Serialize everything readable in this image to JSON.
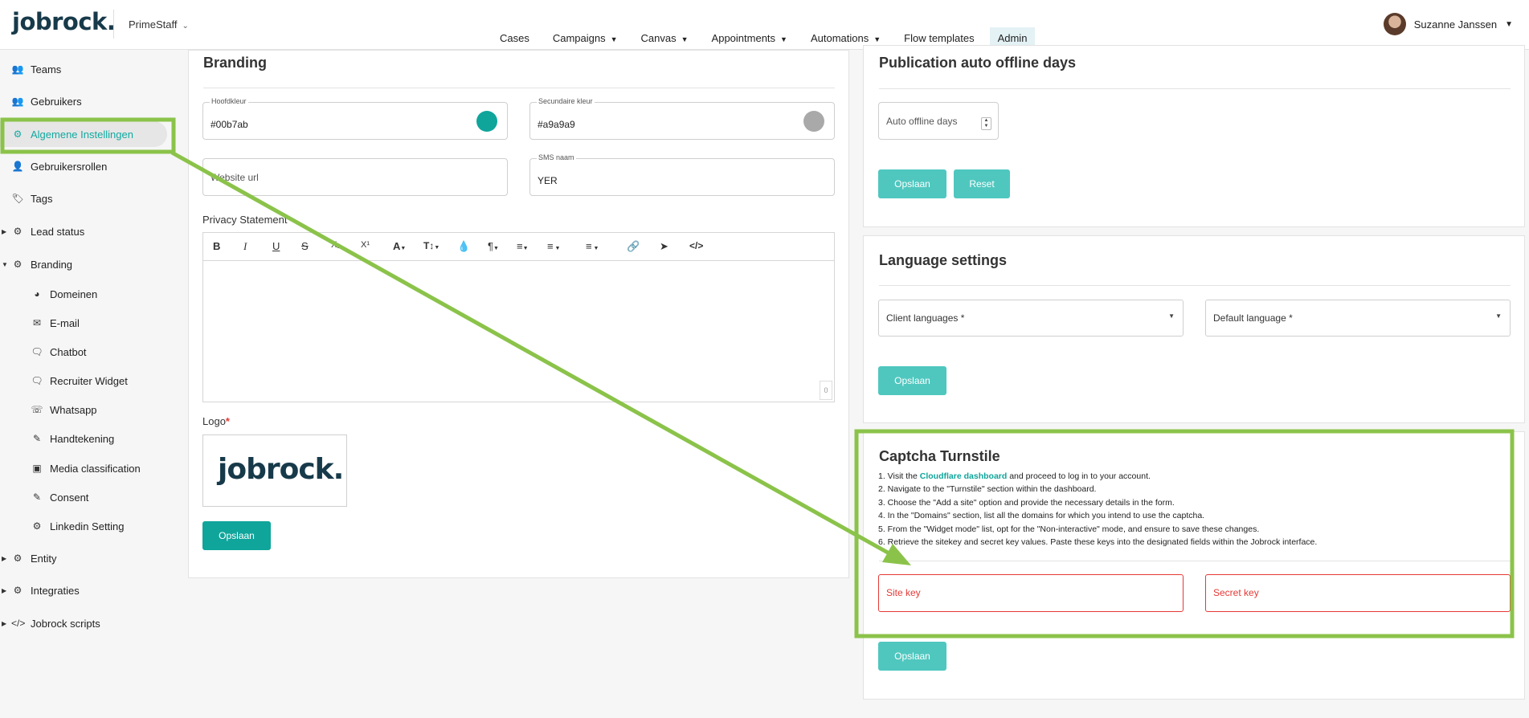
{
  "header": {
    "logo": "jobrock.",
    "org": "PrimeStaff",
    "nav": [
      {
        "label": "Cases",
        "dropdown": false
      },
      {
        "label": "Campaigns",
        "dropdown": true
      },
      {
        "label": "Canvas",
        "dropdown": true
      },
      {
        "label": "Appointments",
        "dropdown": true
      },
      {
        "label": "Automations",
        "dropdown": true
      },
      {
        "label": "Flow templates",
        "dropdown": false
      },
      {
        "label": "Admin",
        "dropdown": false,
        "active": true
      }
    ],
    "user": "Suzanne Janssen"
  },
  "sidebar": {
    "teams": "Teams",
    "users": "Gebruikers",
    "general": "Algemene Instellingen",
    "roles": "Gebruikersrollen",
    "tags": "Tags",
    "lead_status": "Lead status",
    "branding": "Branding",
    "domains": "Domeinen",
    "email": "E-mail",
    "chatbot": "Chatbot",
    "recruiter_widget": "Recruiter Widget",
    "whatsapp": "Whatsapp",
    "signature": "Handtekening",
    "media": "Media classification",
    "consent": "Consent",
    "linkedin": "Linkedin Setting",
    "entity": "Entity",
    "integrations": "Integraties",
    "scripts": "Jobrock scripts"
  },
  "branding": {
    "title": "Branding",
    "primary_label": "Hoofdkleur",
    "primary_value": "#00b7ab",
    "primary_color": "#0fa59b",
    "secondary_label": "Secundaire kleur",
    "secondary_value": "#a9a9a9",
    "secondary_color": "#a9a9a9",
    "website_placeholder": "Website url",
    "sms_label": "SMS naam",
    "sms_value": "YER",
    "privacy_label": "Privacy Statement",
    "counter": "0",
    "logo_label": "Logo",
    "required": "*",
    "logo_text": "jobrock.",
    "save": "Opslaan"
  },
  "publication": {
    "title": "Publication auto offline days",
    "placeholder": "Auto offline days",
    "save": "Opslaan",
    "reset": "Reset"
  },
  "language": {
    "title": "Language settings",
    "client": "Client languages *",
    "default": "Default language *",
    "save": "Opslaan"
  },
  "captcha": {
    "title": "Captcha Turnstile",
    "step1_pre": "1. Visit the ",
    "step1_link": "Cloudflare dashboard",
    "step1_post": " and proceed to log in to your account.",
    "step2": "2. Navigate to the \"Turnstile\" section within the dashboard.",
    "step3": "3. Choose the \"Add a site\" option and provide the necessary details in the form.",
    "step4": "4. In the \"Domains\" section, list all the domains for which you intend to use the captcha.",
    "step5": "5. From the \"Widget mode\" list, opt for the \"Non-interactive\" mode, and ensure to save these changes.",
    "step6": "6. Retrieve the sitekey and secret key values. Paste these keys into the designated fields within the Jobrock interface.",
    "site_key": "Site key",
    "secret_key": "Secret key",
    "save": "Opslaan"
  },
  "annotation_color": "#8bc34a"
}
